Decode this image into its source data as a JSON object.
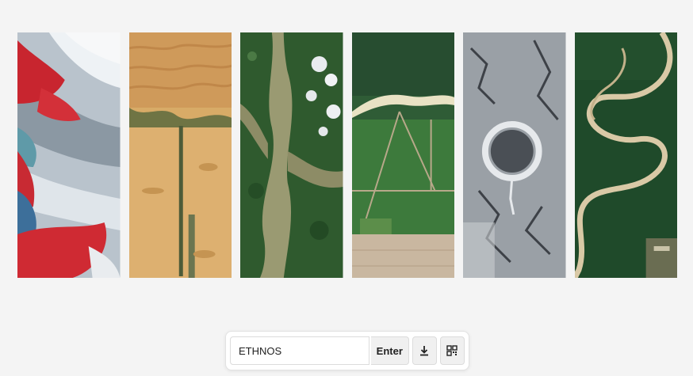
{
  "gallery": {
    "tiles": [
      {
        "subject": "glacier-false-color-image"
      },
      {
        "subject": "desert-dunes-image"
      },
      {
        "subject": "forested-valley-image"
      },
      {
        "subject": "river-farmland-image"
      },
      {
        "subject": "crater-lake-winter-image"
      },
      {
        "subject": "meandering-river-image"
      }
    ]
  },
  "toolbar": {
    "input_value": "ETHNOS",
    "enter_label": "Enter",
    "download_icon": "download-icon",
    "qr_icon": "qr-code-icon"
  },
  "colors": {
    "background": "#f4f4f4",
    "button_bg": "#f0f0f0",
    "border": "#dcdcdc"
  }
}
